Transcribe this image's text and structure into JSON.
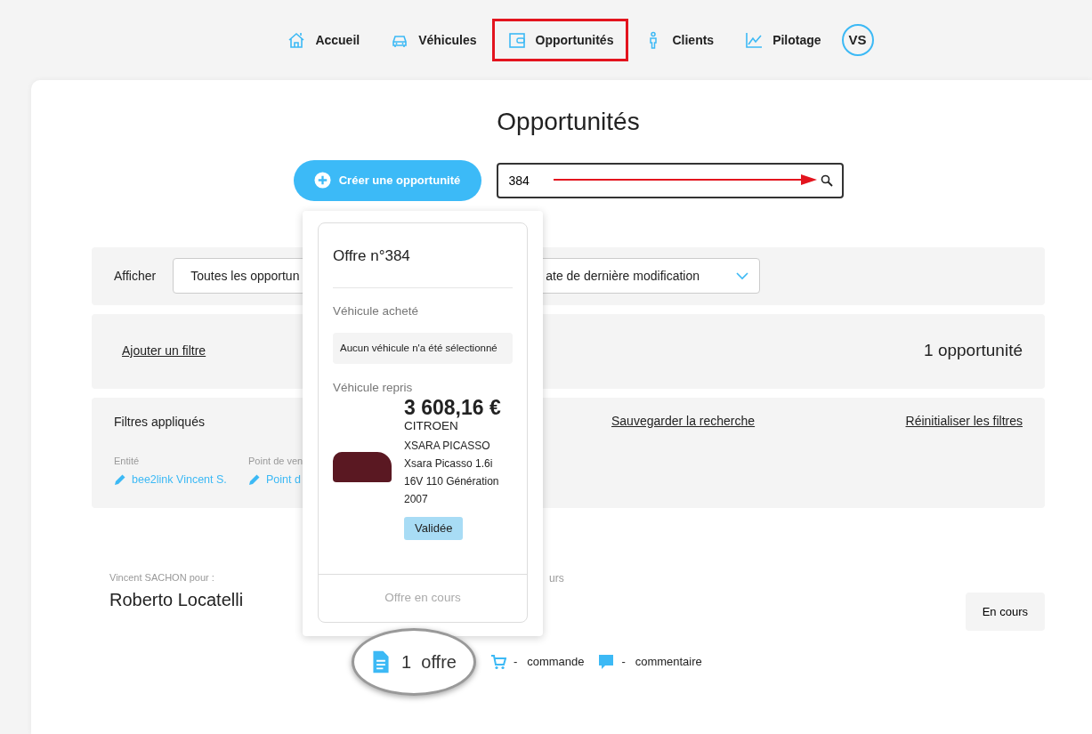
{
  "nav": {
    "items": [
      {
        "kind": "home",
        "label": "Accueil",
        "annotated": false
      },
      {
        "kind": "car",
        "label": "Véhicules",
        "annotated": false
      },
      {
        "kind": "wallet",
        "label": "Opportunités",
        "annotated": true
      },
      {
        "kind": "person",
        "label": "Clients",
        "annotated": false
      },
      {
        "kind": "chart",
        "label": "Pilotage",
        "annotated": false
      }
    ],
    "avatar": "VS"
  },
  "page": {
    "title": "Opportunités",
    "create_button": "Créer une opportunité",
    "search": {
      "value": "384"
    }
  },
  "display_bar": {
    "label": "Afficher",
    "select_1": "Toutes les opportun",
    "select_2": "ate de dernière modification"
  },
  "filter_bar": {
    "add_filter": "Ajouter un filtre",
    "count": "1 opportunité"
  },
  "applied_filters": {
    "title": "Filtres appliqués",
    "save": "Sauvegarder la recherche",
    "reset": "Réinitialiser les filtres",
    "filters": [
      {
        "label": "Entité",
        "value": "bee2link Vincent S."
      },
      {
        "label": "Point de ven",
        "value": "Point d"
      }
    ]
  },
  "opportunity": {
    "author": "Vincent SACHON pour :",
    "client": "Roberto Locatelli",
    "column_2": "urs",
    "status": "En cours",
    "counts": [
      {
        "kind": "offer",
        "number": "1",
        "label": "offre",
        "magnified": true
      },
      {
        "kind": "order",
        "number": "-",
        "label": "commande",
        "magnified": false
      },
      {
        "kind": "comment",
        "number": "-",
        "label": "commentaire",
        "magnified": false
      }
    ]
  },
  "popover": {
    "title": "Offre n°384",
    "bought_label": "Véhicule acheté",
    "bought_value": "Aucun véhicule n'a été sélectionné",
    "tradein_label": "Véhicule repris",
    "price": "3 608,16 €",
    "make": "CITROEN",
    "model": "XSARA PICASSO",
    "version": "Xsara Picasso 1.6i 16V 110 Génération 2007",
    "badge": "Validée",
    "footer": "Offre en cours"
  }
}
